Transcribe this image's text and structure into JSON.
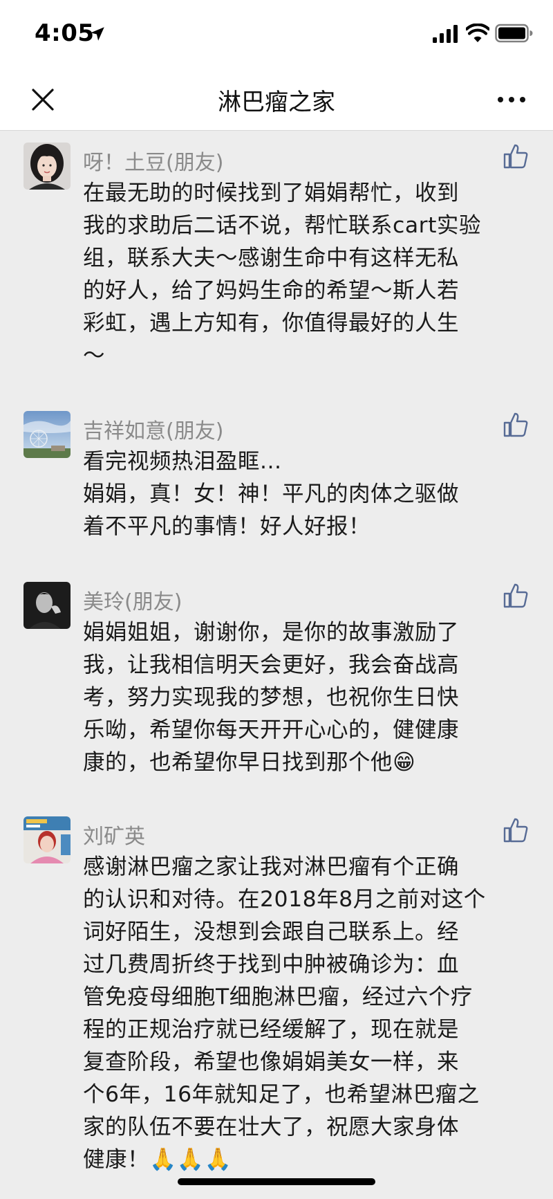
{
  "status_bar": {
    "time": "4:05"
  },
  "nav": {
    "title": "淋巴瘤之家"
  },
  "comments": [
    {
      "name": "呀！土豆(朋友)",
      "text": "在最无助的时候找到了娟娟帮忙，收到\n我的求助后二话不说，帮忙联系cart实验\n组，联系大夫～感谢生命中有这样无私\n的好人，给了妈妈生命的希望～斯人若\n彩虹，遇上方知有，你值得最好的人生\n～"
    },
    {
      "name": "吉祥如意(朋友)",
      "text": "看完视频热泪盈眶...\n娟娟，真！女！神！平凡的肉体之驱做\n着不平凡的事情！好人好报！"
    },
    {
      "name": "美玲(朋友)",
      "text": "娟娟姐姐，谢谢你，是你的故事激励了\n我，让我相信明天会更好，我会奋战高\n考，努力实现我的梦想，也祝你生日快\n乐呦，希望你每天开开心心的，健健康\n康的，也希望你早日找到那个他😁"
    },
    {
      "name": "刘矿英",
      "text": "感谢淋巴瘤之家让我对淋巴瘤有个正确\n的认识和对待。在2018年8月之前对这个\n词好陌生，没想到会跟自己联系上。经\n过几费周折终于找到中肿被确诊为：血\n管免疫母细胞T细胞淋巴瘤，经过六个疗\n程的正规治疗就已经缓解了，现在就是\n复查阶段，希望也像娟娟美女一样，来\n个6年，16年就知足了，也希望淋巴瘤之\n家的队伍不要在壮大了，祝愿大家身体\n健康！🙏🙏🙏"
    }
  ],
  "colors": {
    "background": "#ededed",
    "like_icon": "#576b95",
    "name_text": "#8a8a8a"
  },
  "icons": [
    "location-arrow-icon",
    "signal-icon",
    "wifi-icon",
    "battery-icon",
    "close-icon",
    "more-icon",
    "like-icon"
  ]
}
